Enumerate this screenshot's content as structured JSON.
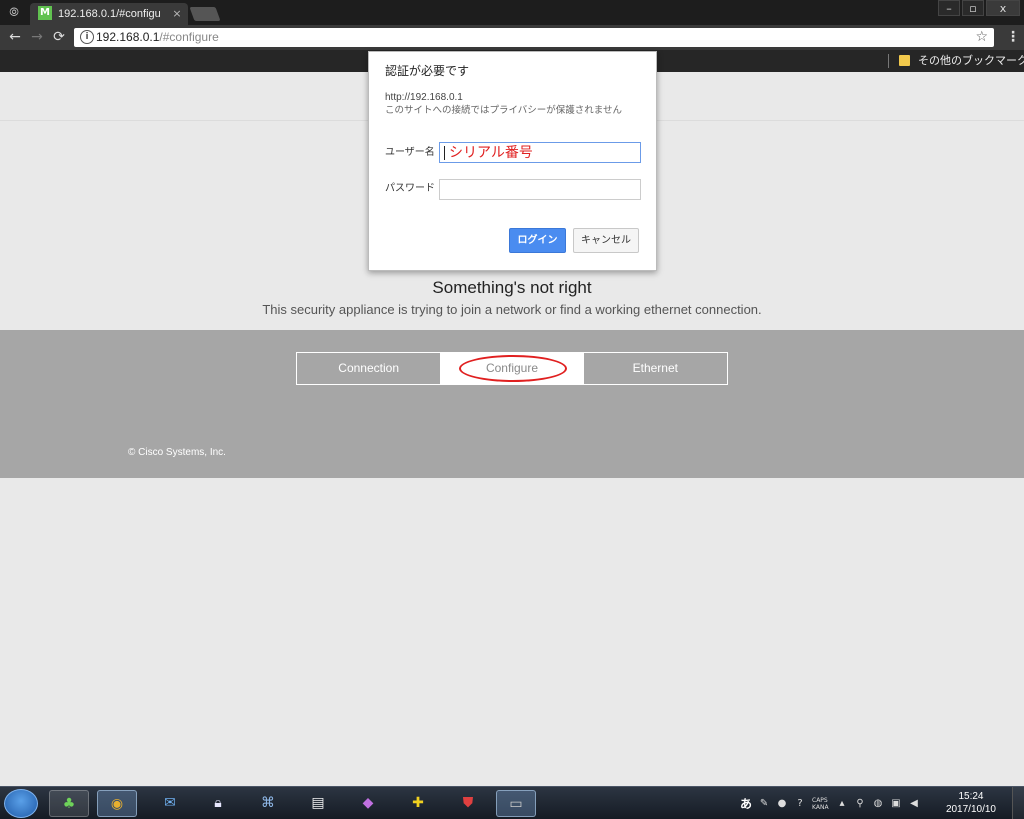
{
  "browser": {
    "tab_title": "192.168.0.1/#configu",
    "tab_favicon_letter": "M",
    "tab_close": "×",
    "url_host": "192.168.0.1",
    "url_path": "/#configure",
    "bookmark_other": "その他のブックマーク",
    "window_controls": {
      "minimize": "–",
      "restore": "▫",
      "close": "x"
    },
    "icons": [
      "incognito-icon",
      "back-arrow-icon",
      "forward-arrow-icon",
      "reload-icon",
      "info-icon",
      "star-icon",
      "menu-icon",
      "folder-icon"
    ]
  },
  "page": {
    "headline": "Something's not right",
    "subline": "This security appliance is trying to join a network or find a working ethernet connection.",
    "tabs": [
      {
        "label": "Connection",
        "active": false
      },
      {
        "label": "Configure",
        "active": true
      },
      {
        "label": "Ethernet",
        "active": false
      }
    ],
    "copyright": "© Cisco Systems, Inc."
  },
  "auth_dialog": {
    "title": "認証が必要です",
    "url": "http://192.168.0.1",
    "privacy_note": "このサイトへの接続ではプライバシーが保護されません",
    "username_label": "ユーザー名",
    "username_value": "シリアル番号",
    "password_label": "パスワード",
    "password_value": "",
    "login_label": "ログイン",
    "cancel_label": "キャンセル",
    "login_color": "#4a8cf0",
    "annotation_color": "#e02020"
  },
  "taskbar": {
    "ime": "あ",
    "caps": "CAPS",
    "kana": "KANA",
    "time": "15:24",
    "date": "2017/10/10"
  }
}
